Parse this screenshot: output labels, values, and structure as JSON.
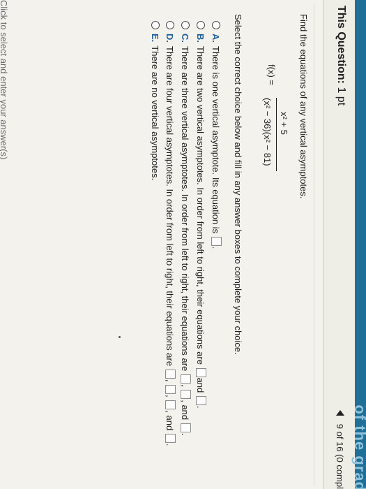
{
  "header": {
    "corner_text": "of the grad",
    "question_label": "This Question:",
    "question_points": "1 pt",
    "progress": "9 of 16 (0 compl"
  },
  "question": {
    "prompt": "Find the equations of any vertical asymptotes.",
    "function_lhs": "f(x) =",
    "numerator": "x² + 5",
    "denominator": "(x² − 36)(x² − 81)",
    "instruction": "Select the correct choice below and fill in any answer boxes to complete your choice."
  },
  "options": [
    {
      "letter": "A.",
      "text": "There is one vertical asymptote. Its equation is",
      "end": "."
    },
    {
      "letter": "B.",
      "text": "There are two vertical asymptotes. In order from left to right, their equations are",
      "and": "and",
      "end": "."
    },
    {
      "letter": "C.",
      "text": "There are three vertical asymptotes. In order from left to right, their equations are",
      "sep": ",",
      "and": "and",
      "end": "."
    },
    {
      "letter": "D.",
      "text": "There are four vertical asymptotes. In order from left to right, their equations are",
      "sep": ",",
      "and": "and",
      "end": "."
    },
    {
      "letter": "E.",
      "text": "There are no vertical asymptotes."
    }
  ],
  "footer": {
    "hint": "Click to select and enter your answer(s)"
  }
}
